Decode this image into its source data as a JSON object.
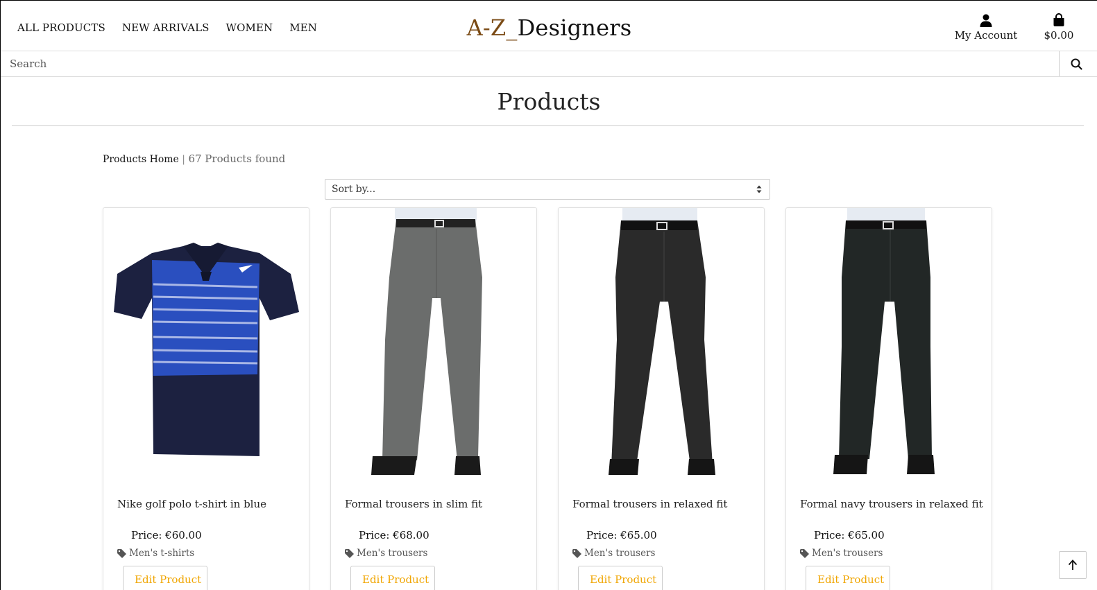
{
  "nav": {
    "items": [
      {
        "label": "ALL PRODUCTS"
      },
      {
        "label": "NEW ARRIVALS"
      },
      {
        "label": "WOMEN"
      },
      {
        "label": "MEN"
      }
    ]
  },
  "logo": {
    "part1": "A-Z_",
    "part2": "Designers"
  },
  "header": {
    "account_label": "My Account",
    "account_icon": "user-icon",
    "bag_total": "$0.00",
    "bag_icon": "shopping-bag-icon"
  },
  "search": {
    "placeholder": "Search",
    "value": "",
    "icon": "search-icon"
  },
  "page": {
    "title": "Products"
  },
  "breadcrumb": {
    "home": "Products Home",
    "separator": "|",
    "count_text": "67 Products found"
  },
  "sort": {
    "selected": "Sort by..."
  },
  "products": [
    {
      "name": "Nike golf polo t-shirt in blue",
      "price": "Price: €60.00",
      "category": "Men's t-shirts",
      "edit_label": "Edit Product"
    },
    {
      "name": "Formal trousers in slim fit",
      "price": "Price: €68.00",
      "category": "Men's trousers",
      "edit_label": "Edit Product"
    },
    {
      "name": "Formal trousers in relaxed fit",
      "price": "Price: €65.00",
      "category": "Men's trousers",
      "edit_label": "Edit Product"
    },
    {
      "name": "Formal navy trousers in relaxed fit",
      "price": "Price: €65.00",
      "category": "Men's trousers",
      "edit_label": "Edit Product"
    }
  ],
  "colors": {
    "accent": "#f0a500",
    "brand": "#7a4a14"
  }
}
